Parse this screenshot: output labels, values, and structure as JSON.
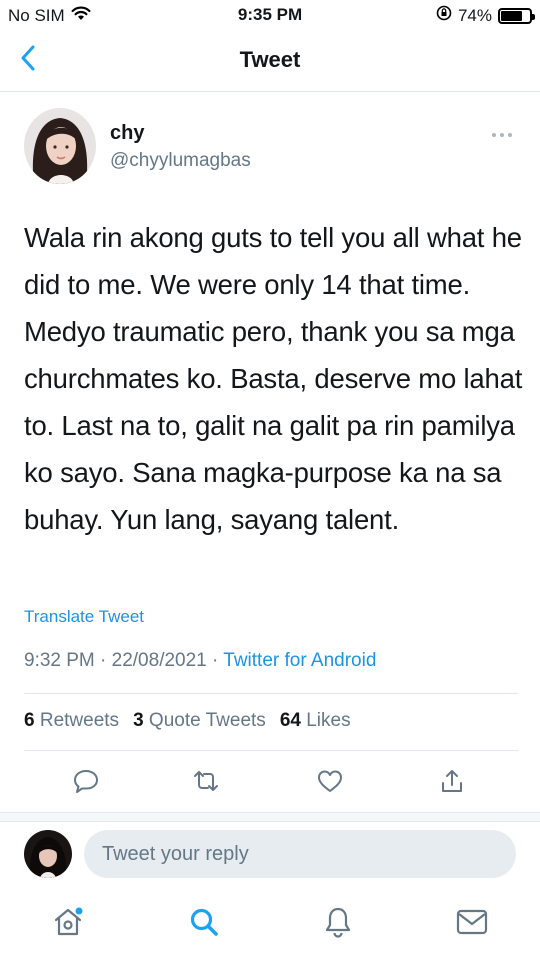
{
  "status_bar": {
    "carrier": "No SIM",
    "time": "9:35 PM",
    "battery_percent": "74%",
    "battery_level": 0.74
  },
  "nav": {
    "title": "Tweet"
  },
  "tweet": {
    "author_name": "chy",
    "author_handle": "@chyylumagbas",
    "text": "Wala rin akong guts to tell you all what he did to me. We were only 14 that time. Medyo traumatic pero, thank you sa mga churchmates ko. Basta, deserve mo lahat to. Last na to, galit na galit pa rin pamilya ko sayo. Sana magka-purpose ka na sa buhay. Yun lang, sayang talent.",
    "translate_label": "Translate Tweet",
    "timestamp": "9:32 PM · 22/08/2021 · ",
    "source": "Twitter for Android",
    "stats": {
      "retweets_count": "6",
      "retweets_label": "Retweets",
      "quotes_count": "3",
      "quotes_label": "Quote Tweets",
      "likes_count": "64",
      "likes_label": "Likes"
    }
  },
  "reply": {
    "placeholder": "Tweet your reply"
  },
  "icons": {
    "accent": "#1da1f2",
    "action_icons": [
      "reply-icon",
      "retweet-icon",
      "like-icon",
      "share-icon"
    ],
    "tab_icons": [
      "home-icon",
      "search-icon",
      "notifications-icon",
      "messages-icon"
    ]
  }
}
